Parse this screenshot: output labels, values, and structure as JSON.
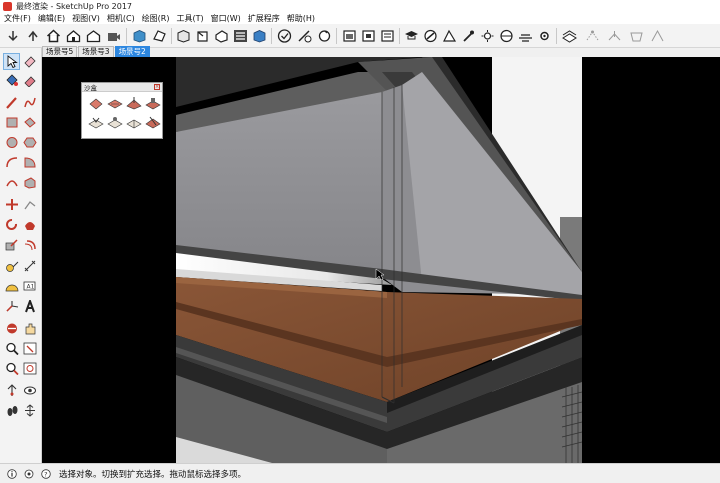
{
  "window": {
    "title": "最终渲染 - SketchUp Pro 2017"
  },
  "menu": [
    "文件(F)",
    "编辑(E)",
    "视图(V)",
    "相机(C)",
    "绘图(R)",
    "工具(T)",
    "窗口(W)",
    "扩展程序",
    "帮助(H)"
  ],
  "scene_tabs": [
    {
      "label": "场景号5"
    },
    {
      "label": "场景号3"
    },
    {
      "label": "场景号2",
      "active": true
    }
  ],
  "tray": {
    "title": "沙盒"
  },
  "status": {
    "text": "选择对象。切换到扩充选择。拖动鼠标选择多项。"
  },
  "colors": {
    "accent": "#2d87e0",
    "wall": "#8f8f93",
    "wood": "#7a4a2e",
    "background": "#000000"
  },
  "toolbar_icons": [
    "house-icon",
    "component-icon",
    "folder-icon",
    "camera-icon",
    "section-plane-icon",
    "paint-bucket-icon",
    "layer-stack-icon",
    "cube-icon",
    "checkmark-icon",
    "eraser-icon",
    "undo-icon",
    "redo-icon",
    "window-icon",
    "monitor-icon",
    "layers-icon",
    "compass-icon",
    "shadow-icon",
    "sun-icon",
    "fog-icon",
    "gear-icon",
    "sandbox-icon",
    "smoove-icon",
    "stamp-icon",
    "drape-icon"
  ],
  "left_tool_icons": [
    "select-arrow-icon",
    "eraser-icon",
    "paint-bucket-icon",
    "line-pencil-icon",
    "freehand-icon",
    "rectangle-icon",
    "rotated-rectangle-icon",
    "circle-icon",
    "polygon-icon",
    "arc-icon",
    "pie-icon",
    "push-pull-icon",
    "follow-me-icon",
    "move-icon",
    "rotate-icon",
    "scale-icon",
    "offset-icon",
    "tape-measure-icon",
    "dimension-icon",
    "protractor-icon",
    "text-icon",
    "axes-icon",
    "3d-text-icon",
    "orbit-icon",
    "pan-icon",
    "zoom-icon",
    "zoom-extents-icon",
    "previous-view-icon",
    "next-view-icon",
    "position-camera-icon",
    "look-around-icon",
    "walk-icon",
    "section-icon"
  ]
}
